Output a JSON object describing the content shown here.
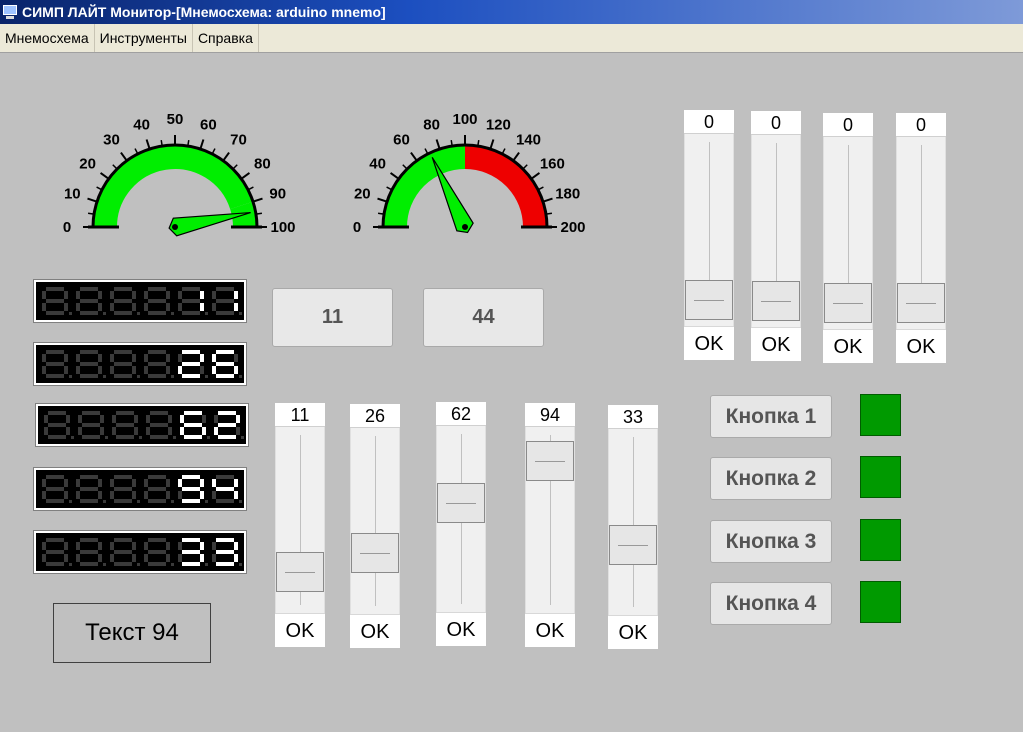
{
  "window": {
    "title": "СИМП ЛАЙТ Монитор-[Мнемосхема: arduino mnemo]"
  },
  "menu": [
    "Мнемосхема",
    "Инструменты",
    "Справка"
  ],
  "colors": {
    "ok_zone": "#00ee00",
    "alarm_zone": "#ee0000",
    "led_on": "#009a00",
    "segment_on": "#ffffff",
    "segment_off": "#3a3a3a"
  },
  "gauges": [
    {
      "min": 0,
      "max": 100,
      "value": 94,
      "green_to": 90,
      "red_from": null,
      "labels": [
        "0",
        "10",
        "20",
        "30",
        "40",
        "50",
        "60",
        "70",
        "80",
        "90",
        "100"
      ]
    },
    {
      "min": 0,
      "max": 200,
      "value": 72,
      "green_to": 100,
      "red_from": 100,
      "labels": [
        "0",
        "20",
        "40",
        "60",
        "80",
        "100",
        "120",
        "140",
        "160",
        "180",
        "200"
      ]
    }
  ],
  "digital_displays": [
    {
      "value": "11"
    },
    {
      "value": "26"
    },
    {
      "value": "62"
    },
    {
      "value": "94"
    },
    {
      "value": "33"
    }
  ],
  "value_buttons": [
    {
      "label": "11"
    },
    {
      "label": "44"
    }
  ],
  "top_sliders": [
    {
      "value": "0",
      "level": 0,
      "ok": "OK"
    },
    {
      "value": "0",
      "level": 0,
      "ok": "OK"
    },
    {
      "value": "0",
      "level": 0,
      "ok": "OK"
    },
    {
      "value": "0",
      "level": 0,
      "ok": "OK"
    }
  ],
  "bottom_sliders": [
    {
      "value": "11",
      "level": 11,
      "ok": "OK"
    },
    {
      "value": "26",
      "level": 26,
      "ok": "OK"
    },
    {
      "value": "62",
      "level": 62,
      "ok": "OK"
    },
    {
      "value": "94",
      "level": 94,
      "ok": "OK"
    },
    {
      "value": "33",
      "level": 33,
      "ok": "OK"
    }
  ],
  "buttons": [
    {
      "label": "Кнопка 1"
    },
    {
      "label": "Кнопка 2"
    },
    {
      "label": "Кнопка 3"
    },
    {
      "label": "Кнопка 4"
    }
  ],
  "text_box": {
    "text": "Текст 94"
  }
}
